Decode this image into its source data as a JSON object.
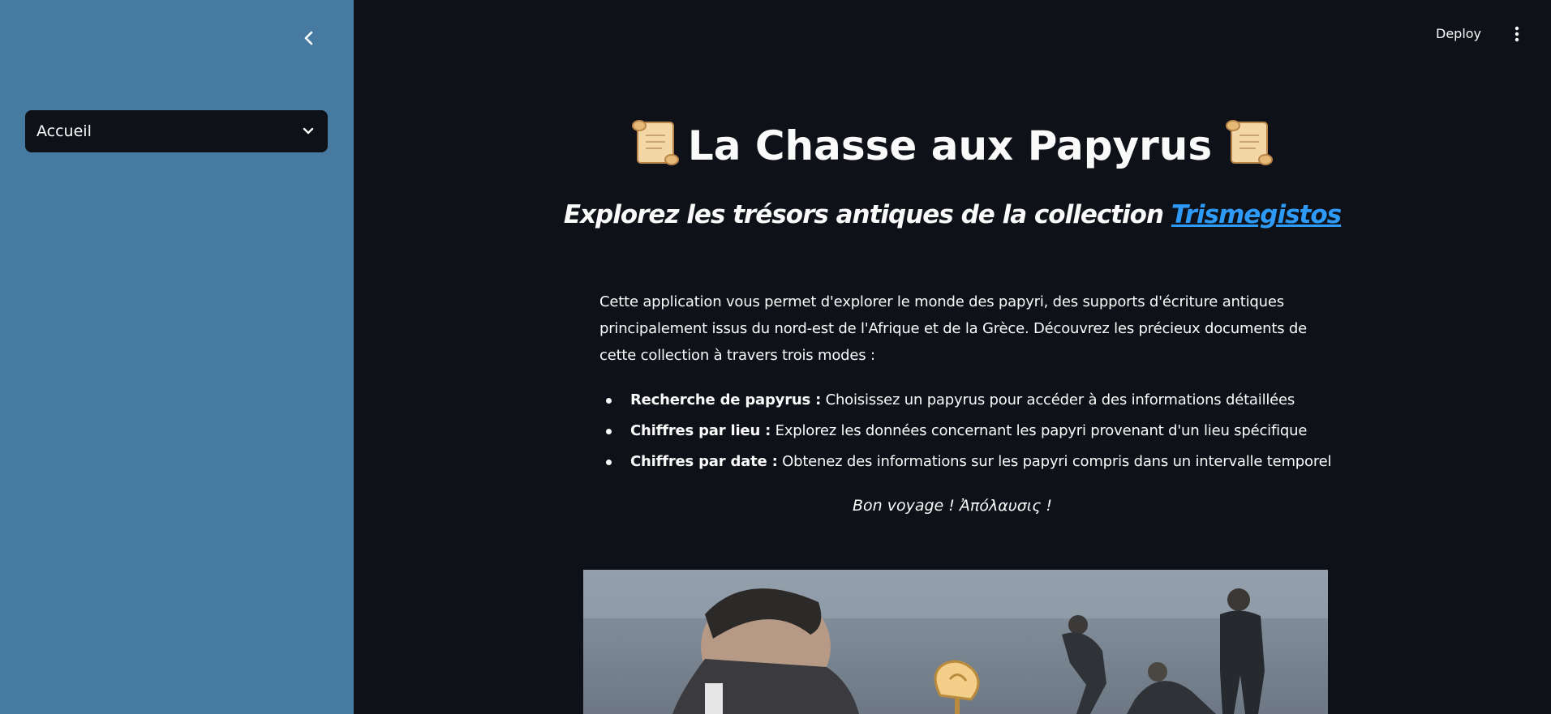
{
  "sidebar": {
    "collapse_icon": "chevron-left-icon",
    "nav_select": {
      "value": "Accueil",
      "icon": "chevron-down-icon"
    },
    "background_color": "#467aa0"
  },
  "header": {
    "deploy_label": "Deploy",
    "menu_icon": "vertical-dots-icon"
  },
  "main": {
    "title_icon": "scroll-emoji",
    "title": "La Chasse aux Papyrus",
    "subtitle_prefix": "Explorez les trésors antiques de la collection ",
    "subtitle_link": "Trismegistos",
    "intro": "Cette application vous permet d'explorer le monde des papyri, des supports d'écriture antiques principalement issus du nord-est de l'Afrique et de la Grèce. Découvrez les précieux documents de cette collection à travers trois modes :",
    "modes": [
      {
        "title": "Recherche de papyrus :",
        "text": " Choisissez un papyrus pour accéder à des informations détaillées"
      },
      {
        "title": "Chiffres par lieu :",
        "text": " Explorez les données concernant les papyri provenant d'un lieu spécifique"
      },
      {
        "title": "Chiffres par date :",
        "text": " Obtenez des informations sur les papyri compris dans un intervalle temporel"
      }
    ],
    "farewell": "Bon voyage ! Ἀπόλαυσις !",
    "hero_image": "meme-photo-men-on-beach-with-rose"
  },
  "colors": {
    "background": "#0e1117",
    "text": "#fafafa",
    "link": "#2e9af7",
    "sidebar": "#467aa0"
  }
}
